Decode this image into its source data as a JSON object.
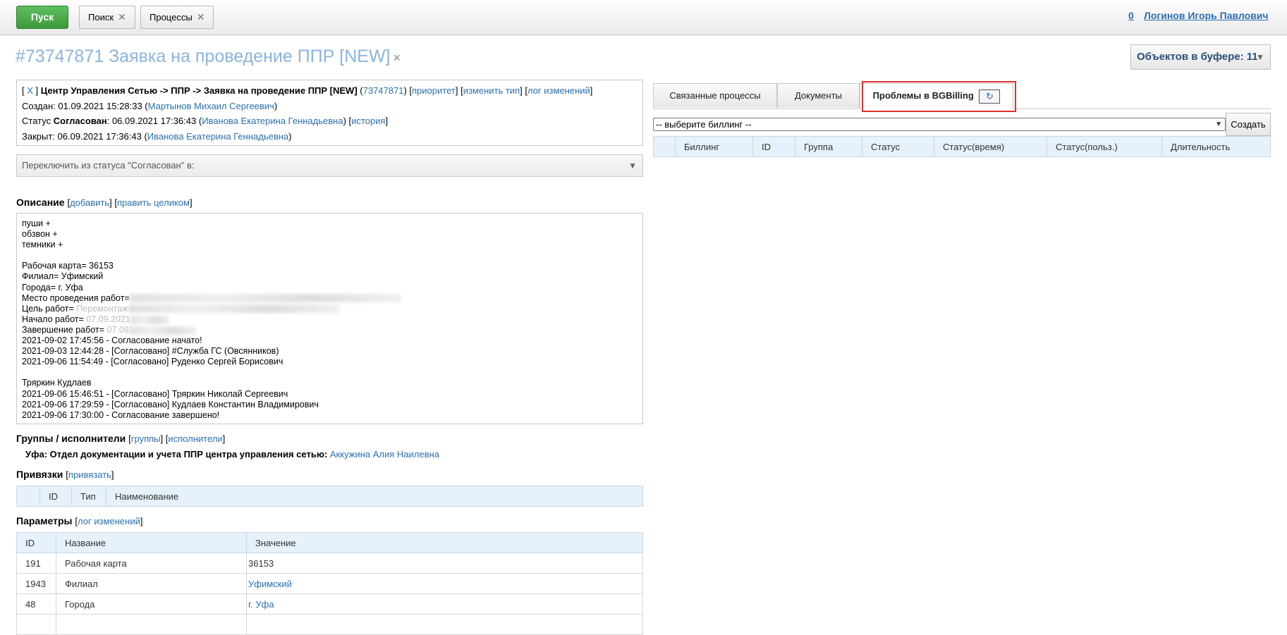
{
  "topbar": {
    "start_label": "Пуск",
    "tabs": [
      {
        "label": "Поиск"
      },
      {
        "label": "Процессы"
      }
    ],
    "user_count": "0",
    "user_name": "Логинов Игорь Павлович"
  },
  "title": {
    "text": "#73747871 Заявка на проведение ППР [NEW]",
    "close": "×"
  },
  "buffer": {
    "label": "Объектов в буфере: 11"
  },
  "info": {
    "close_x": "X",
    "path": "Центр Управления Сетью -> ППР -> Заявка на проведение ППР [NEW]",
    "id_link": "73747871",
    "priority_link": "приоритет",
    "change_type_link": "изменить тип",
    "change_log_link": "лог изменений",
    "created_label": "Создан:",
    "created_date": "01.09.2021 15:28:33",
    "created_by": "Мартынов Михаил Сергеевич",
    "status_label": "Статус",
    "status_value": "Согласован",
    "status_date": "06.09.2021 17:36:43",
    "status_by": "Иванова Екатерина Геннадьевна",
    "history_link": "история",
    "closed_label": "Закрыт:",
    "closed_date": "06.09.2021 17:36:43",
    "closed_by": "Иванова Екатерина Геннадьевна"
  },
  "status_switch": {
    "label": "Переключить из статуса \"Согласован\" в:"
  },
  "description": {
    "heading": "Описание",
    "add_link": "добавить",
    "edit_link": "править целиком",
    "lines": [
      "пуши +",
      "обзвон +",
      "темники +",
      "",
      "Рабочая карта= 36153",
      "Филиал= Уфимский",
      "Города= г. Уфа",
      "Место проведения работ=",
      "Цель работ=",
      "Начало работ=",
      "Завершение работ=",
      "2021-09-02 17:45:56 - Согласование начато!",
      "2021-09-03 12:44:28 - [Согласовано] #Служба ГС (Овсянников)",
      "2021-09-06 11:54:49 - [Согласовано] Руденко Сергей Борисович",
      "",
      "Тряркин Кудлаев",
      "2021-09-06 15:46:51 - [Согласовано] Тряркин Николай Сергеевич",
      "2021-09-06 17:29:59 - [Согласовано] Кудлаев Константин Владимирович",
      "2021-09-06 17:30:00 - Согласование завершено!"
    ],
    "partial_goal": "Перемонтаж",
    "partial_start": "07.09.2021",
    "partial_end": "07.09"
  },
  "groups": {
    "heading": "Группы / исполнители",
    "groups_link": "группы",
    "executors_link": "исполнители",
    "line_bold": "Уфа: Отдел документации и учета ППР центра управления сетью:",
    "line_person": "Аккужина Алия Наилевна"
  },
  "links_section": {
    "heading": "Привязки",
    "bind_link": "привязать",
    "columns": [
      "",
      "ID",
      "Тип",
      "Наименование"
    ]
  },
  "params": {
    "heading": "Параметры",
    "log_link": "лог изменений",
    "columns": [
      "ID",
      "Название",
      "Значение"
    ],
    "rows": [
      {
        "id": "191",
        "name": "Рабочая карта",
        "value": "36153"
      },
      {
        "id": "1943",
        "name": "Филиал",
        "value": "Уфимский"
      },
      {
        "id": "48",
        "name": "Города",
        "value": "г. Уфа"
      }
    ]
  },
  "right_tabs": [
    {
      "label": "Связанные процессы"
    },
    {
      "label": "Документы"
    },
    {
      "label": "Проблемы в BGBilling"
    }
  ],
  "refresh_icon": "↻",
  "billing": {
    "select_value": "-- выберите биллинг --",
    "create_label": "Создать",
    "columns": [
      "",
      "Биллинг",
      "ID",
      "Группа",
      "Статус",
      "Статус(время)",
      "Статус(польз.)",
      "Длительность"
    ]
  },
  "colors": {
    "accent": "#2a6fb5",
    "title": "#8bb4e0",
    "start": "#3b9a3b",
    "highlight": "#e0302c"
  }
}
